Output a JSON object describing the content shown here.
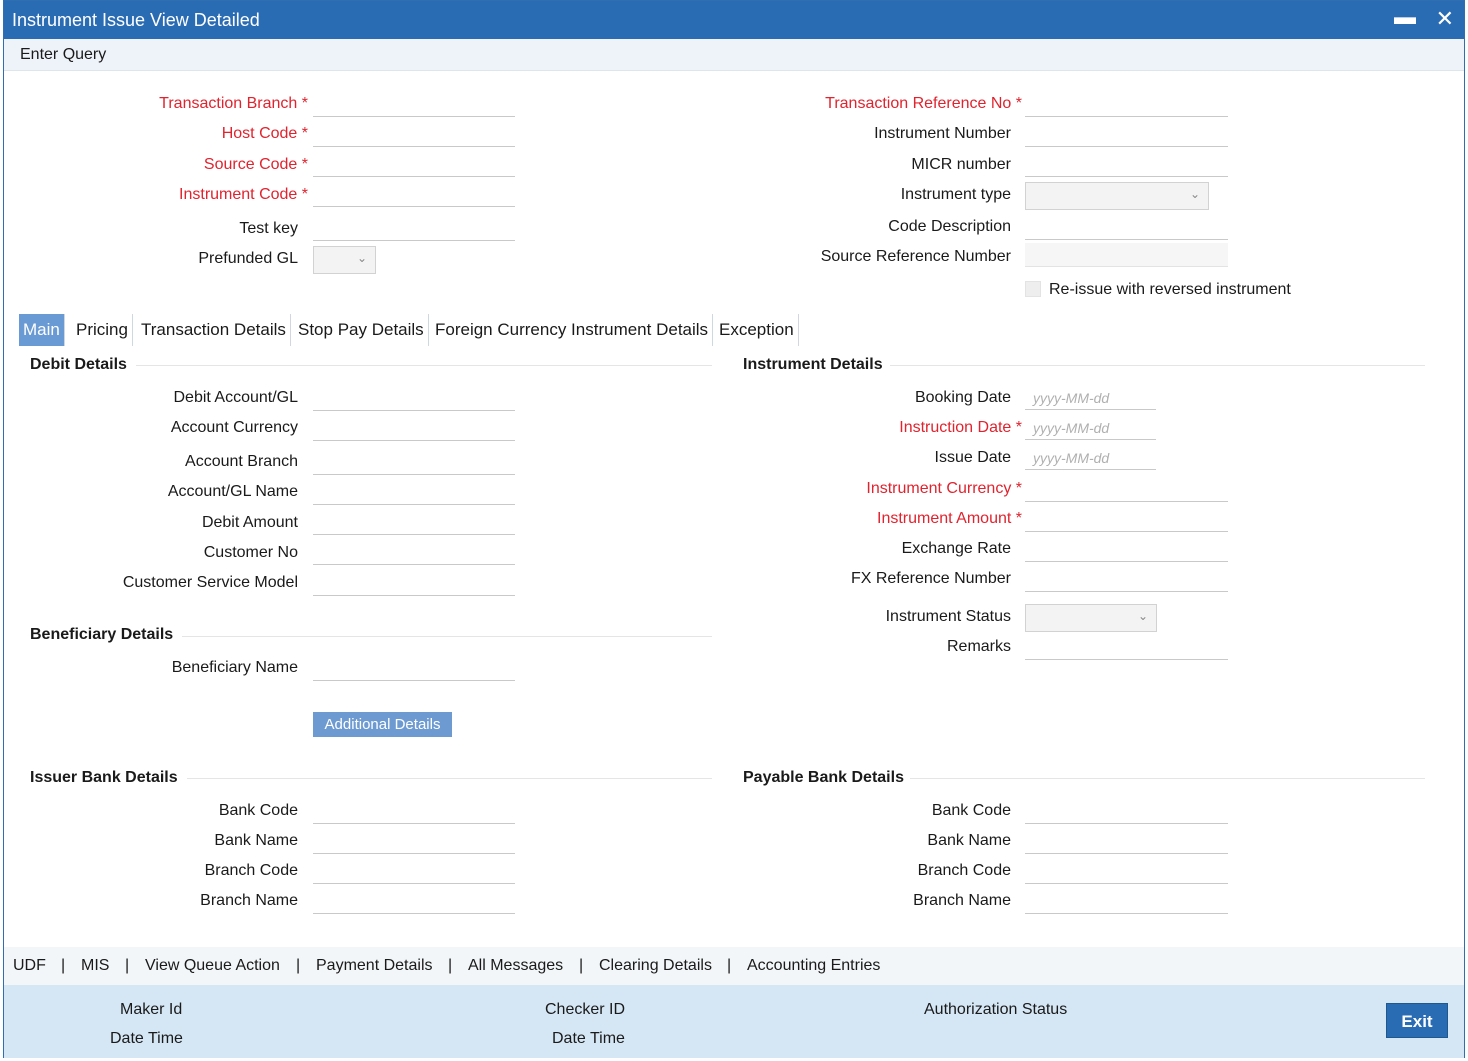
{
  "window": {
    "title": "Instrument Issue View Detailed",
    "minimize_glyph": "▬",
    "close_glyph": "✕"
  },
  "menu": {
    "enter_query": "Enter Query"
  },
  "header_left": {
    "transaction_branch": "Transaction Branch",
    "host_code": "Host Code",
    "source_code": "Source Code",
    "instrument_code": "Instrument Code",
    "test_key": "Test key",
    "prefunded_gl": "Prefunded GL"
  },
  "header_right": {
    "transaction_reference_no": "Transaction Reference No",
    "instrument_number": "Instrument Number",
    "micr_number": "MICR number",
    "instrument_type": "Instrument type",
    "code_description": "Code Description",
    "source_reference_number": "Source Reference Number",
    "reissue": "Re-issue with reversed instrument"
  },
  "required_marker": "*",
  "tabs": [
    "Main",
    "Pricing",
    "Transaction Details",
    "Stop Pay Details",
    "Foreign Currency Instrument Details",
    "Exception"
  ],
  "debit": {
    "title": "Debit Details",
    "debit_account": "Debit Account/GL",
    "account_currency": "Account Currency",
    "account_branch": "Account Branch",
    "account_name": "Account/GL Name",
    "debit_amount": "Debit Amount",
    "customer_no": "Customer No",
    "customer_service_model": "Customer Service Model"
  },
  "beneficiary": {
    "title": "Beneficiary Details",
    "name": "Beneficiary Name",
    "additional_details": "Additional Details"
  },
  "instrument": {
    "title": "Instrument Details",
    "booking_date": "Booking Date",
    "instruction_date": "Instruction Date",
    "issue_date": "Issue Date",
    "date_placeholder": "yyyy-MM-dd",
    "instrument_currency": "Instrument Currency",
    "instrument_amount": "Instrument Amount",
    "exchange_rate": "Exchange Rate",
    "fx_reference_number": "FX Reference Number",
    "instrument_status": "Instrument Status",
    "remarks": "Remarks"
  },
  "issuer_bank": {
    "title": "Issuer Bank Details",
    "bank_code": "Bank Code",
    "bank_name": "Bank Name",
    "branch_code": "Branch Code",
    "branch_name": "Branch Name"
  },
  "payable_bank": {
    "title": "Payable Bank Details",
    "bank_code": "Bank Code",
    "bank_name": "Bank Name",
    "branch_code": "Branch Code",
    "branch_name": "Branch Name"
  },
  "bottom_links": [
    "UDF",
    "MIS",
    "View Queue Action",
    "Payment Details",
    "All Messages",
    "Clearing Details",
    "Accounting Entries"
  ],
  "link_separator": "|",
  "footer": {
    "maker_id": "Maker Id",
    "date_time_1": "Date Time",
    "checker_id": "Checker ID",
    "date_time_2": "Date Time",
    "authorization_status": "Authorization Status",
    "exit": "Exit"
  },
  "colors": {
    "title_bar": "#2a6cb4",
    "required": "#e0232e",
    "active_tab": "#6a9ad3",
    "footer": "#d5e7f5"
  }
}
